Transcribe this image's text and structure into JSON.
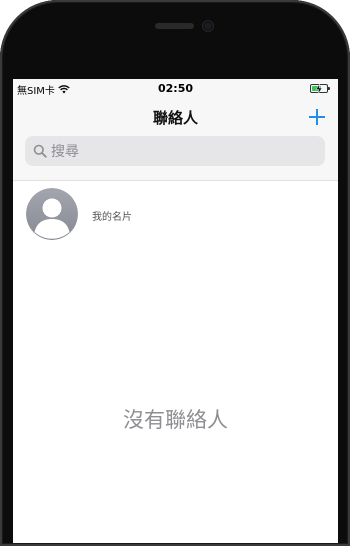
{
  "status_bar": {
    "carrier": "無SIM卡",
    "wifi_icon": "wifi-icon",
    "time": "02:50",
    "battery_icon": "battery-charging-icon"
  },
  "nav": {
    "title": "聯絡人",
    "add_icon": "plus-icon",
    "add_symbol": "+"
  },
  "search": {
    "placeholder": "搜尋",
    "icon": "search-icon"
  },
  "my_card": {
    "label": "我的名片",
    "avatar_icon": "person-avatar-icon"
  },
  "empty_state": {
    "text": "沒有聯絡人"
  },
  "colors": {
    "accent": "#1f8ef1",
    "battery": "#34c759",
    "secondary_text": "#8e8e93"
  }
}
